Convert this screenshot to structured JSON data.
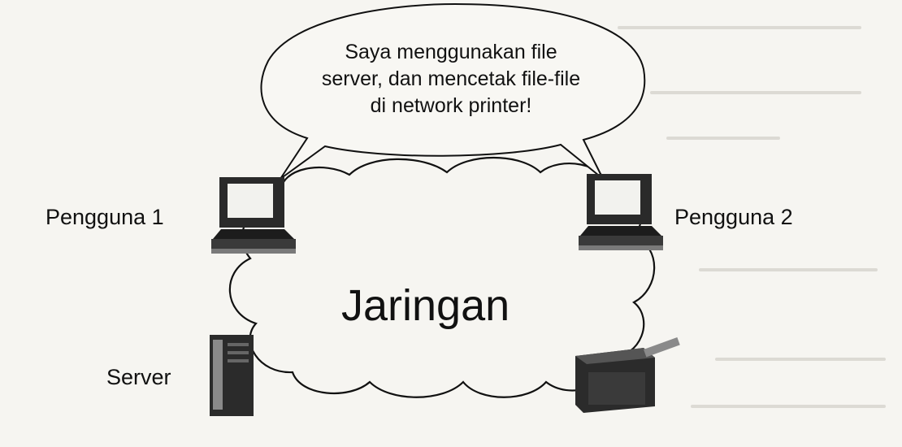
{
  "speech_bubble": {
    "lines": [
      "Saya menggunakan file",
      "server, dan mencetak file-file",
      "di network printer!"
    ]
  },
  "network_label": "Jaringan",
  "nodes": {
    "user1": "Pengguna 1",
    "user2": "Pengguna 2",
    "server": "Server"
  }
}
